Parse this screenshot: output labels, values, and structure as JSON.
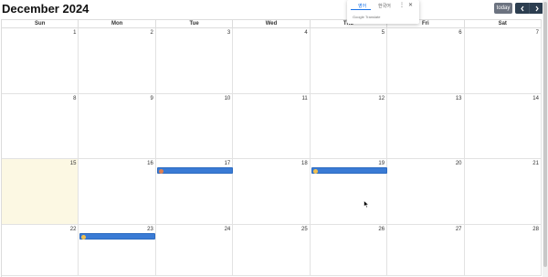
{
  "header": {
    "title": "December 2024",
    "today_label": "today"
  },
  "weekdays": [
    "Sun",
    "Mon",
    "Tue",
    "Wed",
    "Thu",
    "Fri",
    "Sat"
  ],
  "weeks": [
    [
      "1",
      "2",
      "3",
      "4",
      "5",
      "6",
      "7"
    ],
    [
      "8",
      "9",
      "10",
      "11",
      "12",
      "13",
      "14"
    ],
    [
      "15",
      "16",
      "17",
      "18",
      "19",
      "20",
      "21"
    ],
    [
      "22",
      "23",
      "24",
      "25",
      "26",
      "27",
      "28"
    ]
  ],
  "today": "15",
  "events": [
    {
      "day": "17",
      "icon": "event-avatar-icon"
    },
    {
      "day": "19",
      "icon": "event-avatar-icon"
    },
    {
      "day": "23",
      "icon": "event-avatar-icon"
    }
  ],
  "translate_popup": {
    "tab_source": "영어",
    "tab_target": "한국어",
    "brand": "Google Translate"
  },
  "colors": {
    "event": "#3a7bd5",
    "today_bg": "#fcf8e3",
    "nav": "#2c3e50",
    "today_btn": "#6c7380"
  }
}
